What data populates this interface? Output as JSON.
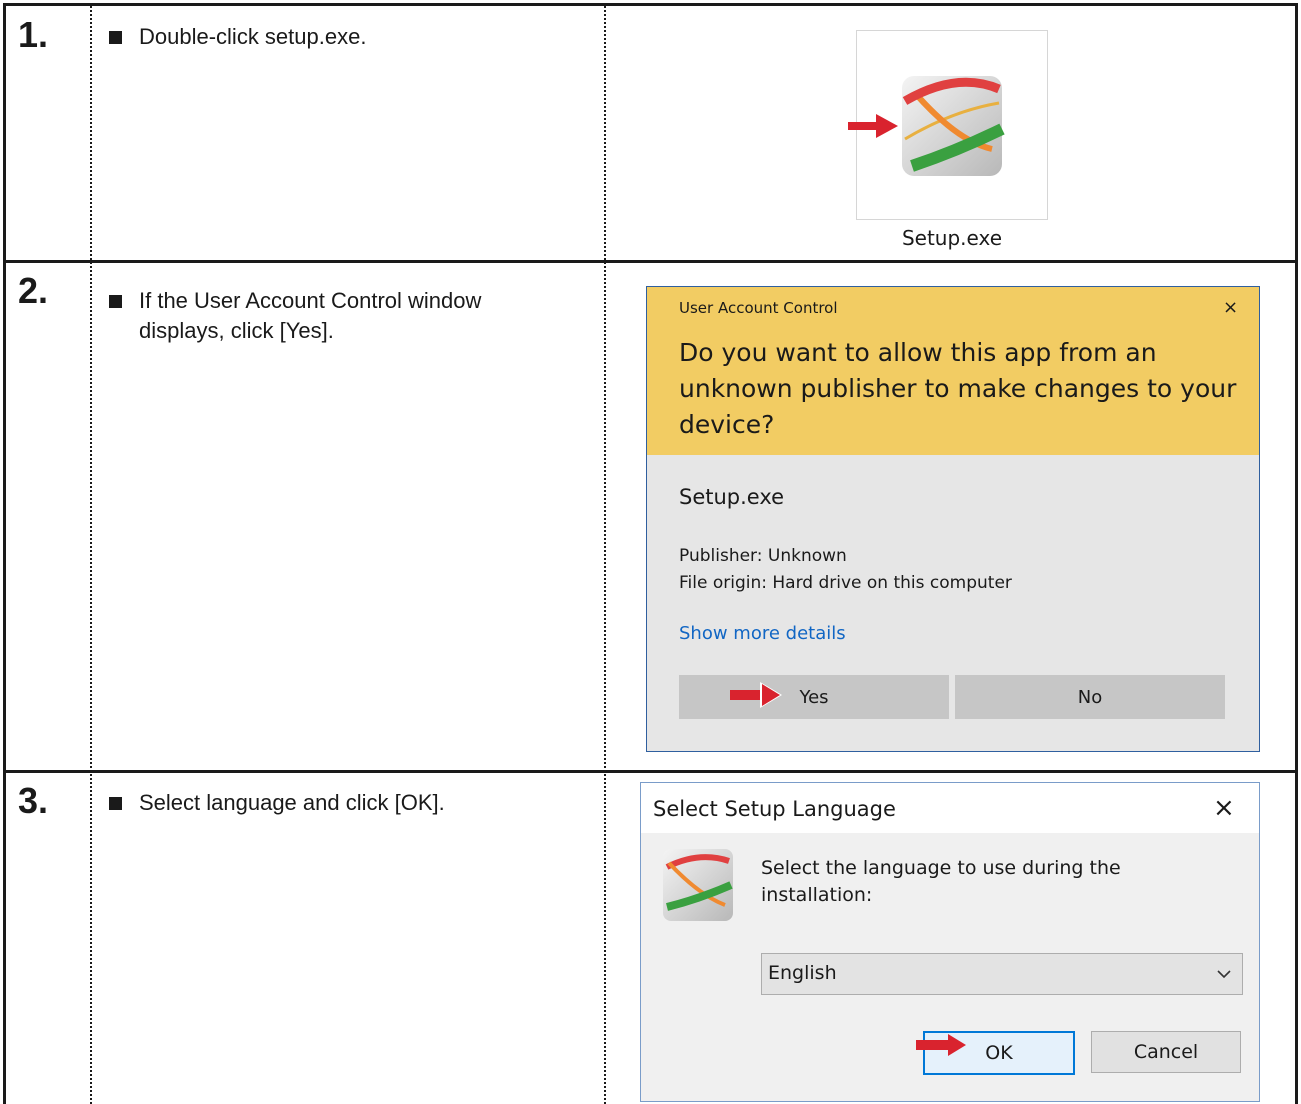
{
  "steps": [
    {
      "number": "1.",
      "text": "Double-click setup.exe."
    },
    {
      "number": "2.",
      "text": "If the User Account Control window displays, click [Yes]."
    },
    {
      "number": "3.",
      "text": "Select language and click [OK]."
    }
  ],
  "file_icon": {
    "label": "Setup.exe",
    "icon": "setup-app-icon"
  },
  "uac": {
    "title": "User Account Control",
    "close": "×",
    "question": "Do you want to allow this app from an unknown publisher to make changes to your device?",
    "app_name": "Setup.exe",
    "publisher": "Publisher: Unknown",
    "origin": "File origin: Hard drive on this computer",
    "details_link": "Show more details",
    "yes_label": "Yes",
    "no_label": "No",
    "header_color": "#f2cc63"
  },
  "lang_dialog": {
    "title": "Select Setup Language",
    "close": "×",
    "prompt": "Select the language to use during the installation:",
    "selected_language": "English",
    "ok_label": "OK",
    "cancel_label": "Cancel"
  },
  "colors": {
    "arrow": "#d9232e",
    "link": "#1166c4"
  }
}
